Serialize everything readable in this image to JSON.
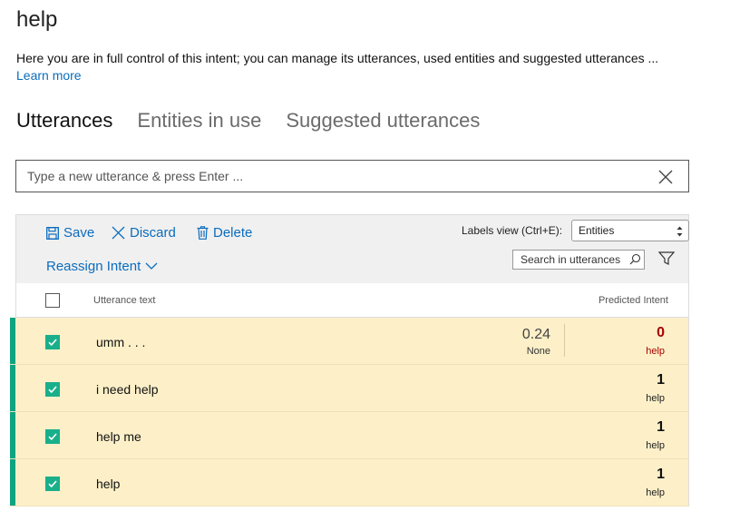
{
  "page": {
    "title": "help",
    "description": "Here you are in full control of this intent; you can manage its utterances, used entities and suggested utterances ...",
    "learn_more": "Learn more"
  },
  "tabs": [
    {
      "label": "Utterances",
      "active": true
    },
    {
      "label": "Entities in use",
      "active": false
    },
    {
      "label": "Suggested utterances",
      "active": false
    }
  ],
  "utterance_input": {
    "placeholder": "Type a new utterance & press Enter ...",
    "value": ""
  },
  "toolbar": {
    "save_label": "Save",
    "discard_label": "Discard",
    "delete_label": "Delete",
    "reassign_label": "Reassign Intent",
    "labels_view_label": "Labels view (Ctrl+E):",
    "labels_view_selected": "Entities",
    "search_placeholder": "Search in utterances"
  },
  "table": {
    "col_utterance": "Utterance text",
    "col_predicted": "Predicted Intent",
    "rows": [
      {
        "text": "umm . . .",
        "score": "0.24",
        "score_label": "None",
        "predicted": "0",
        "predicted_label": "help",
        "checked": true,
        "mismatch": true
      },
      {
        "text": "i need help",
        "score": "",
        "score_label": "",
        "predicted": "1",
        "predicted_label": "help",
        "checked": true,
        "mismatch": false
      },
      {
        "text": "help me",
        "score": "",
        "score_label": "",
        "predicted": "1",
        "predicted_label": "help",
        "checked": true,
        "mismatch": false
      },
      {
        "text": "help",
        "score": "",
        "score_label": "",
        "predicted": "1",
        "predicted_label": "help",
        "checked": true,
        "mismatch": false
      }
    ]
  },
  "colors": {
    "accent": "#10a37f",
    "link": "#0b6cbd",
    "row_background": "#fdf0c8",
    "error": "#a80000"
  }
}
